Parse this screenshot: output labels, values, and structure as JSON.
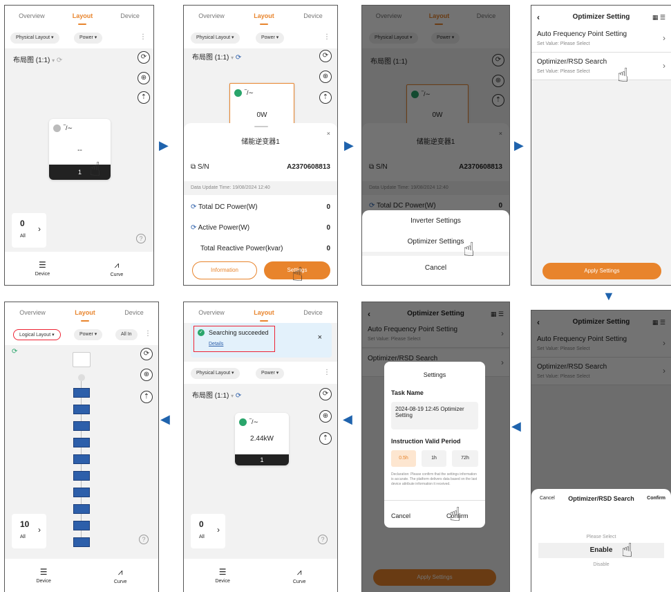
{
  "tabs": {
    "overview": "Overview",
    "layout": "Layout",
    "device": "Device"
  },
  "filters": {
    "physical": "Physical Layout",
    "power": "Power",
    "logical": "Logical Layout",
    "all": "All In"
  },
  "layout_label": "布局图 (1:1)",
  "p1": {
    "tile_value": "--",
    "tile_count": "1",
    "all_count": "0",
    "all_label": "All"
  },
  "p2": {
    "tile_value": "0W",
    "sheet_title": "储能逆变器1",
    "sn_label": "S/N",
    "sn_value": "A2370608813",
    "update": "Data Update Time: 19/08/2024 12:40",
    "rows": [
      {
        "label": "Total DC Power(W)",
        "value": "0"
      },
      {
        "label": "Active Power(W)",
        "value": "0"
      },
      {
        "label": "Total Reactive Power(kvar)",
        "value": "0"
      }
    ],
    "info_btn": "Information",
    "settings_btn": "Settings"
  },
  "p3": {
    "menu": [
      "Inverter Settings",
      "Optimizer Settings"
    ],
    "cancel": "Cancel"
  },
  "opt": {
    "title": "Optimizer Setting",
    "row1": "Auto Frequency Point Setting",
    "row2": "Optimizer/RSD Search",
    "sub": "Set Value: Please Select",
    "apply": "Apply Settings"
  },
  "p5": {
    "cancel": "Cancel",
    "title": "Optimizer/RSD Search",
    "confirm": "Confirm",
    "please": "Please Select",
    "enable": "Enable",
    "disable": "Disable"
  },
  "p6": {
    "dlg_title": "Settings",
    "task_label": "Task Name",
    "task_value": "2024-08-19 12:45 Optimizer Setting",
    "period_label": "Instruction Valid Period",
    "periods": [
      "0.5h",
      "1h",
      "72h"
    ],
    "decl": "Declaration: Please confirm that the settings information is accurate. The platform delivers data based on the last device attribute information it received.",
    "cancel": "Cancel",
    "confirm": "Confirm"
  },
  "p7": {
    "toast": "Searching succeeded",
    "details": "Details",
    "tile_value": "2.44kW",
    "tile_count": "1",
    "all_count": "0"
  },
  "p8": {
    "all_count": "10",
    "all_label": "All"
  },
  "nav": {
    "device": "Device",
    "curve": "Curve"
  },
  "colors": {
    "accent": "#e8842c",
    "arrow": "#1f63ad",
    "success": "#2aa56b"
  }
}
